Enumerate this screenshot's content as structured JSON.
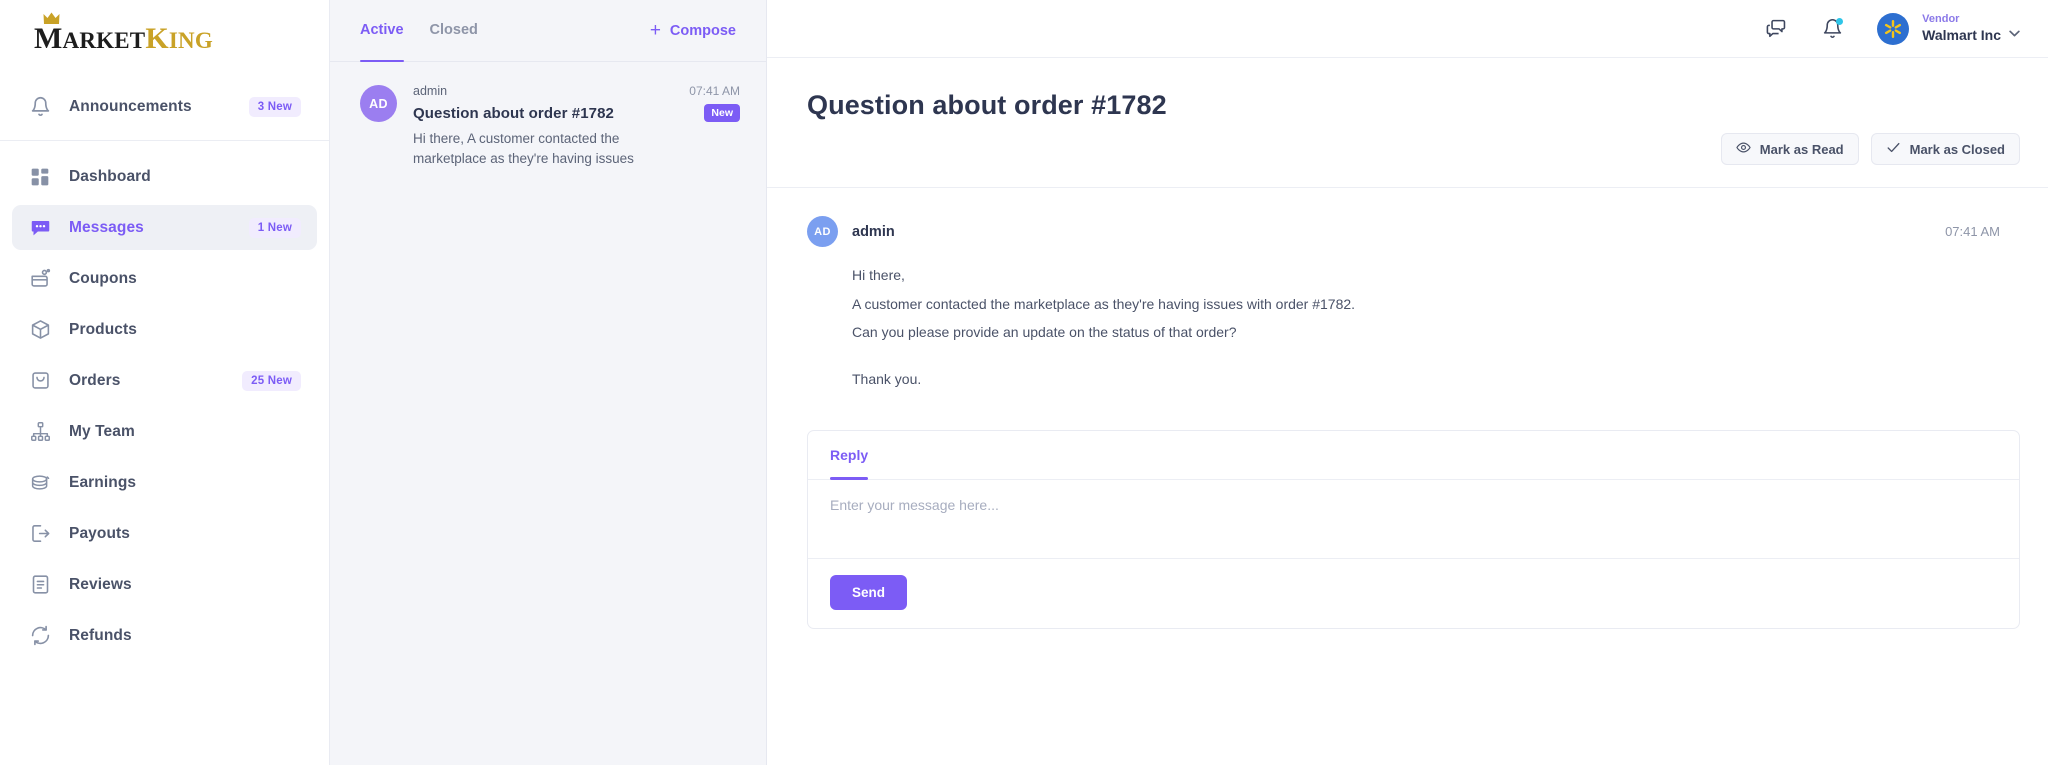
{
  "brand": {
    "word1": "M",
    "word1rest": "ARKET",
    "word2": "K",
    "word2rest": "ING",
    "crown": "♕"
  },
  "sidebar": {
    "announcements": {
      "label": "Announcements",
      "badge": "3 New",
      "icon": "bell-icon"
    },
    "items": [
      {
        "label": "Dashboard",
        "badge": "",
        "icon": "grid-icon",
        "active": false
      },
      {
        "label": "Messages",
        "badge": "1 New",
        "icon": "chat-icon",
        "active": true
      },
      {
        "label": "Coupons",
        "badge": "",
        "icon": "coupon-icon",
        "active": false
      },
      {
        "label": "Products",
        "badge": "",
        "icon": "box-icon",
        "active": false
      },
      {
        "label": "Orders",
        "badge": "25 New",
        "icon": "bag-icon",
        "active": false
      },
      {
        "label": "My Team",
        "badge": "",
        "icon": "team-icon",
        "active": false
      },
      {
        "label": "Earnings",
        "badge": "",
        "icon": "coins-icon",
        "active": false
      },
      {
        "label": "Payouts",
        "badge": "",
        "icon": "payout-icon",
        "active": false
      },
      {
        "label": "Reviews",
        "badge": "",
        "icon": "review-icon",
        "active": false
      },
      {
        "label": "Refunds",
        "badge": "",
        "icon": "refund-icon",
        "active": false
      }
    ]
  },
  "topbar": {
    "chat_icon": "chat-bubbles-icon",
    "bell_icon": "bell-notification-icon",
    "vendor_label": "Vendor",
    "vendor_name": "Walmart Inc",
    "chevron": "⌄",
    "accent": "#7c5cf5"
  },
  "list": {
    "tabs": [
      {
        "label": "Active",
        "selected": true
      },
      {
        "label": "Closed",
        "selected": false
      }
    ],
    "compose_label": "Compose",
    "compose_plus": "+",
    "threads": [
      {
        "initials": "AD",
        "sender": "admin",
        "time": "07:41 AM",
        "subject": "Question about order #1782",
        "badge": "New",
        "snippet": "Hi there, A customer contacted the marketplace as they're having issues"
      }
    ]
  },
  "main": {
    "title": "Question about order #1782",
    "mark_read_label": "Mark as Read",
    "mark_closed_label": "Mark as Closed",
    "message": {
      "initials": "AD",
      "author": "admin",
      "time": "07:41 AM",
      "line1": "Hi there,",
      "line2": "A customer contacted the marketplace as they're having issues with order #1782.",
      "line3": "Can you please provide an update on the status of that order?",
      "line4": "Thank you."
    },
    "reply": {
      "tab_label": "Reply",
      "placeholder": "Enter your message here...",
      "send_label": "Send"
    }
  }
}
